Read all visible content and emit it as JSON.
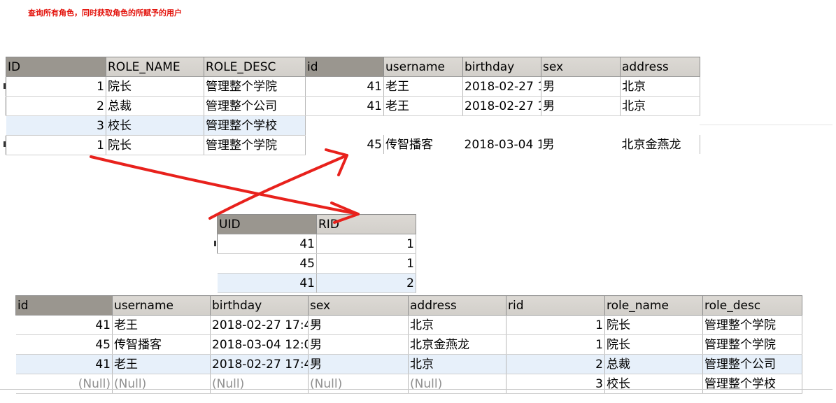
{
  "title": "查询所有角色，同时获取角色的所赋予的用户",
  "roles_table": {
    "columns": [
      "ID",
      "ROLE_NAME",
      "ROLE_DESC"
    ],
    "rows": [
      [
        "1",
        "院长",
        "管理整个学院"
      ],
      [
        "2",
        "总裁",
        "管理整个公司"
      ],
      [
        "3",
        "校长",
        "管理整个学校"
      ],
      [
        "1",
        "院长",
        "管理整个学院"
      ]
    ]
  },
  "users_table": {
    "columns": [
      "id",
      "username",
      "birthday",
      "sex",
      "address"
    ],
    "rows": [
      [
        "41",
        "老王",
        "2018-02-27 1",
        "男",
        "北京"
      ],
      [
        "41",
        "老王",
        "2018-02-27 1",
        "男",
        "北京"
      ],
      [
        "45",
        "传智播客",
        "2018-03-04 1",
        "男",
        "北京金燕龙"
      ]
    ]
  },
  "user_role_table": {
    "columns": [
      "UID",
      "RID"
    ],
    "rows": [
      [
        "41",
        "1"
      ],
      [
        "45",
        "1"
      ],
      [
        "41",
        "2"
      ]
    ]
  },
  "result_table": {
    "columns": [
      "id",
      "username",
      "birthday",
      "sex",
      "address",
      "rid",
      "role_name",
      "role_desc"
    ],
    "rows": [
      [
        "41",
        "老王",
        "2018-02-27 17:4",
        "男",
        "北京",
        "1",
        "院长",
        "管理整个学院"
      ],
      [
        "45",
        "传智播客",
        "2018-03-04 12:0",
        "男",
        "北京金燕龙",
        "1",
        "院长",
        "管理整个学院"
      ],
      [
        "41",
        "老王",
        "2018-02-27 17:4",
        "男",
        "北京",
        "2",
        "总裁",
        "管理整个公司"
      ],
      [
        "(Null)",
        "(Null)",
        "(Null)",
        "(Null)",
        "(Null)",
        "3",
        "校长",
        "管理整个学校"
      ]
    ]
  },
  "colors": {
    "title_red": "#e3120b",
    "arrow_red": "#e8211c",
    "selected_row": "#e7f0fa",
    "header_bg": "#d6d3ce",
    "null_text": "#8f8f8f"
  },
  "icons": [
    "row-pointer-icon",
    "red-arrow-icon"
  ]
}
